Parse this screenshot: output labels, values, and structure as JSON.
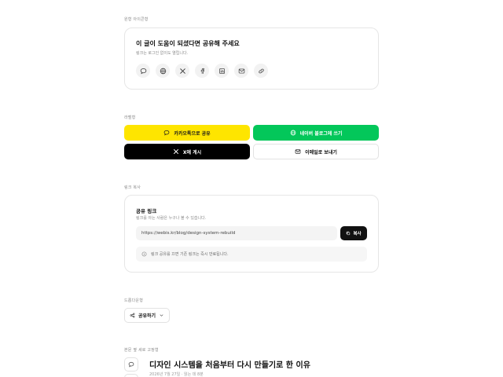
{
  "sections": {
    "icon_share": "원형 아이콘형",
    "text_buttons": "라벨형",
    "link_copy": "링크 복사",
    "dropdown": "드롭다운형",
    "fixed_side": "본문 옆 세로 고정형"
  },
  "icon_card": {
    "title": "이 글이 도움이 되셨다면 공유해 주세요",
    "subtitle": "링크는 로그인 없이도 열립니다.",
    "icons": [
      "kakaotalk-icon",
      "globe-icon",
      "x-icon",
      "facebook-icon",
      "linkedin-icon",
      "mail-icon",
      "link-icon"
    ]
  },
  "buttons": {
    "kakao": "카카오톡으로 공유",
    "naver": "네이버 블로그에 쓰기",
    "x": "X에 게시",
    "email": "이메일로 보내기",
    "colors": {
      "kakao": "#fee500",
      "naver": "#03c75a",
      "x": "#000000"
    }
  },
  "link_card": {
    "title": "공유 링크",
    "subtitle": "링크를 아는 사람은 누구나 볼 수 있습니다.",
    "url": "https://webis.kr/blog/design-system-rebuild",
    "copy_label": "복사",
    "info": "링크 공유를 끄면 기존 링크는 즉시 만료됩니다."
  },
  "dropdown": {
    "label": "공유하기"
  },
  "post": {
    "title": "디자인 시스템을 처음부터 다시 만들기로 한 이유",
    "meta": "2026년 7월 27일 · 읽는 데 8분"
  }
}
